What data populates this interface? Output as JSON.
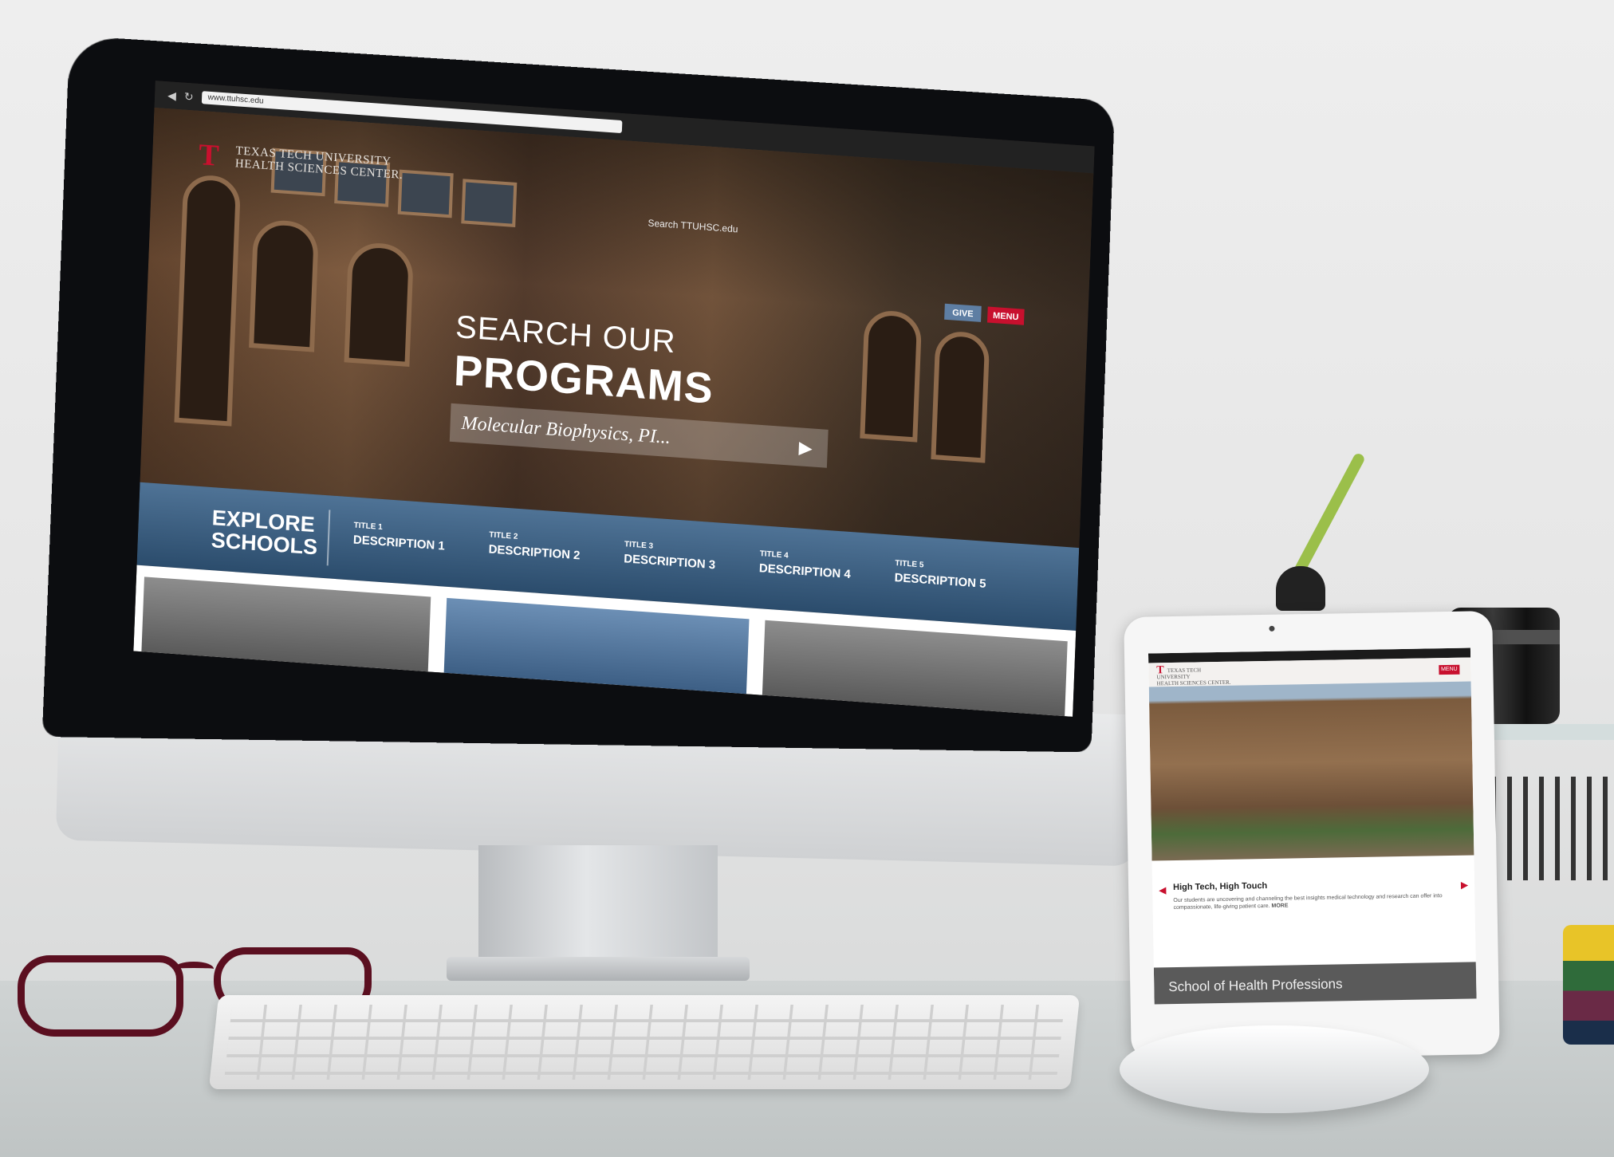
{
  "desktop": {
    "browser": {
      "back_icon": "back-arrow-icon",
      "reload_icon": "reload-icon",
      "url": "www.ttuhsc.edu"
    },
    "logo": {
      "mark": "T",
      "line1": "TEXAS TECH UNIVERSITY",
      "line2": "HEALTH SCIENCES CENTER."
    },
    "search_placeholder": "Search TTUHSC.edu",
    "give_label": "GIVE",
    "menu_label": "MENU",
    "hero": {
      "title_line1": "SEARCH OUR",
      "title_line2": "PROGRAMS",
      "program_value": "Molecular Biophysics, PI...",
      "play_icon": "play-arrow-icon"
    },
    "explore": {
      "line1": "EXPLORE",
      "line2": "SCHOOLS"
    },
    "schools": [
      {
        "title": "TITLE 1",
        "desc": "DESCRIPTION 1"
      },
      {
        "title": "TITLE 2",
        "desc": "DESCRIPTION 2"
      },
      {
        "title": "TITLE 3",
        "desc": "DESCRIPTION 3"
      },
      {
        "title": "TITLE 4",
        "desc": "DESCRIPTION 4"
      },
      {
        "title": "TITLE 5",
        "desc": "DESCRIPTION 5"
      }
    ]
  },
  "tablet": {
    "logo_line1": "TEXAS TECH UNIVERSITY",
    "logo_line2": "HEALTH SCIENCES CENTER.",
    "menu_label": "MENU",
    "caption_title": "High Tech, High Touch",
    "caption_body": "Our students are uncovering and channeling the best insights medical technology and research can offer into compassionate, life-giving patient care.",
    "caption_more": "MORE",
    "school_bar": "School of Health Professions"
  },
  "colors": {
    "brand_red": "#c8102e",
    "give_blue": "#5e7ea3",
    "schools_bar_top": "#4f7396",
    "schools_bar_bottom": "#2b4c6c"
  }
}
